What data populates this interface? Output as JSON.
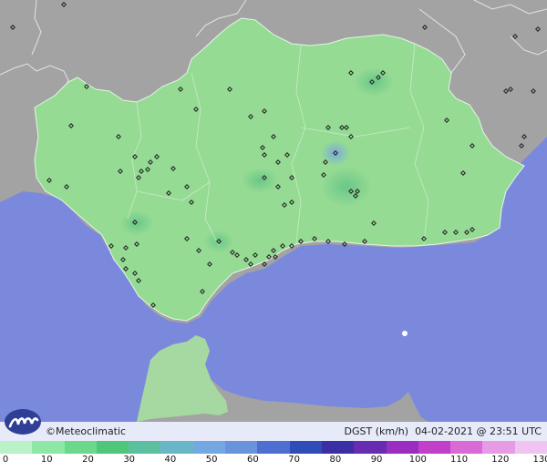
{
  "brand": {
    "name": "©Meteoclimatic"
  },
  "legend": {
    "variable": "DGST (km/h)",
    "timestamp": "04-02-2021 @ 23:51 UTC",
    "ticks": [
      "0",
      "10",
      "20",
      "30",
      "40",
      "50",
      "60",
      "70",
      "80",
      "90",
      "100",
      "110",
      "120",
      "130"
    ],
    "colors": [
      "#b9f2c7",
      "#8fe7a5",
      "#6ad98b",
      "#4ec77a",
      "#5cc0a0",
      "#69b6c8",
      "#74a8e2",
      "#6b93dc",
      "#4c6fd0",
      "#2f4cb8",
      "#3b2fa6",
      "#6a2bb3",
      "#9a2ec0",
      "#c23fc9",
      "#d96ad6",
      "#e79be5",
      "#f1c3f0"
    ]
  },
  "colors": {
    "sea": "#7b89dd",
    "land_outside": "#a3a3a3",
    "andalusia": "#95db94",
    "morocco": "#a6d9a2",
    "station": "#222222",
    "logo": "#2f3f96"
  },
  "icons": {
    "logo": "meteoclimatic-logo-icon",
    "station": "station-marker-icon"
  }
}
